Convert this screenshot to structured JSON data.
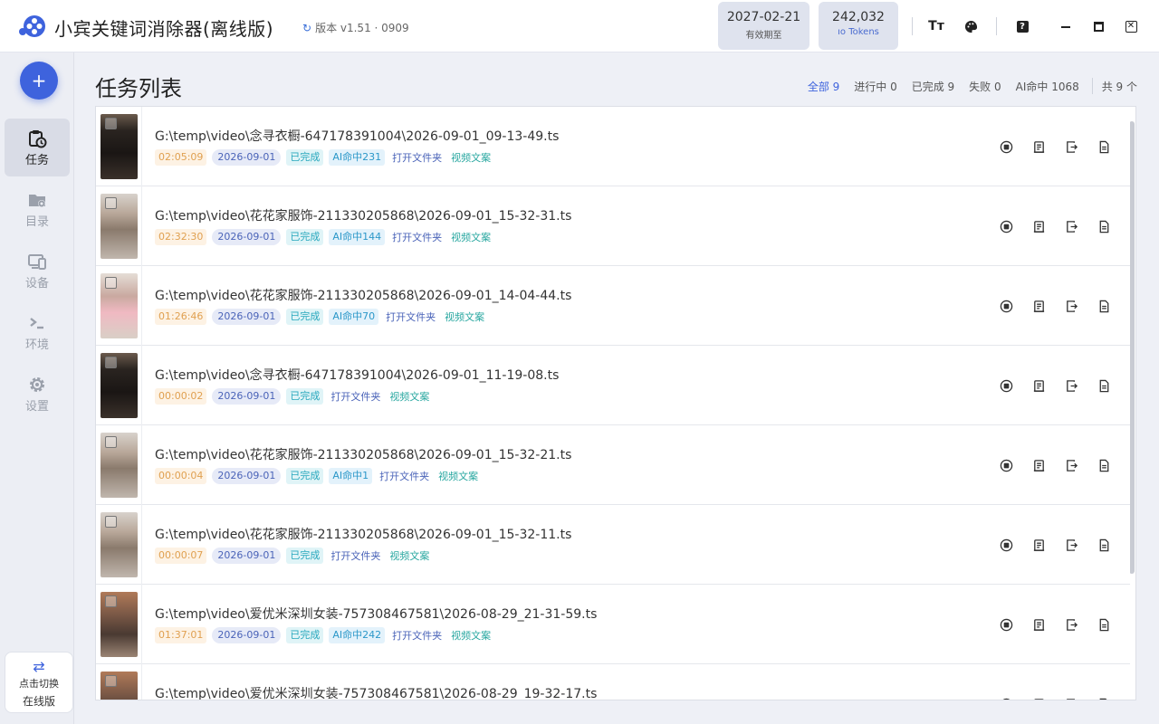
{
  "app": {
    "title": "小宾关键词消除器(离线版)",
    "version": "版本 v1.51 · 0909",
    "expiry_date": "2027-02-21",
    "expiry_label": "有效期至",
    "tokens_value": "242,032",
    "tokens_label": "Tokens"
  },
  "toolbar": {
    "font_btn": "Tт",
    "help_btn": "?"
  },
  "sidebar": {
    "add_label": "+",
    "items": [
      {
        "label": "任务",
        "icon": "task-icon",
        "active": true
      },
      {
        "label": "目录",
        "icon": "folder-gear-icon",
        "active": false
      },
      {
        "label": "设备",
        "icon": "device-icon",
        "active": false
      },
      {
        "label": "环境",
        "icon": "terminal-icon",
        "active": false
      },
      {
        "label": "设置",
        "icon": "gear-icon",
        "active": false
      }
    ],
    "switch": {
      "line1": "点击切换",
      "line2": "在线版"
    }
  },
  "page": {
    "title": "任务列表",
    "filters": {
      "all": "全部 9",
      "running": "进行中 0",
      "done": "已完成 9",
      "failed": "失败 0",
      "ai_hits": "AI命中 1068",
      "total": "共 9 个"
    }
  },
  "colors": {
    "accent": "#3e63dd",
    "duration": "#e0a050",
    "done": "#28a7bd"
  },
  "link_labels": {
    "open_folder": "打开文件夹",
    "video_text": "视频文案"
  },
  "tasks": [
    {
      "path": "G:\\temp\\video\\念寻衣橱-647178391004\\2026-09-01_09-13-49.ts",
      "duration": "02:05:09",
      "date": "2026-09-01",
      "status": "已完成",
      "ai": "AI命中231",
      "thumb": "dark"
    },
    {
      "path": "G:\\temp\\video\\花花家服饰-211330205868\\2026-09-01_15-32-31.ts",
      "duration": "02:32:30",
      "date": "2026-09-01",
      "status": "已完成",
      "ai": "AI命中144",
      "thumb": "light"
    },
    {
      "path": "G:\\temp\\video\\花花家服饰-211330205868\\2026-09-01_14-04-44.ts",
      "duration": "01:26:46",
      "date": "2026-09-01",
      "status": "已完成",
      "ai": "AI命中70",
      "thumb": "pink"
    },
    {
      "path": "G:\\temp\\video\\念寻衣橱-647178391004\\2026-09-01_11-19-08.ts",
      "duration": "00:00:02",
      "date": "2026-09-01",
      "status": "已完成",
      "ai": "",
      "thumb": "dark"
    },
    {
      "path": "G:\\temp\\video\\花花家服饰-211330205868\\2026-09-01_15-32-21.ts",
      "duration": "00:00:04",
      "date": "2026-09-01",
      "status": "已完成",
      "ai": "AI命中1",
      "thumb": "light"
    },
    {
      "path": "G:\\temp\\video\\花花家服饰-211330205868\\2026-09-01_15-32-11.ts",
      "duration": "00:00:07",
      "date": "2026-09-01",
      "status": "已完成",
      "ai": "",
      "thumb": "light"
    },
    {
      "path": "G:\\temp\\video\\爱优米深圳女装-757308467581\\2026-08-29_21-31-59.ts",
      "duration": "01:37:01",
      "date": "2026-09-01",
      "status": "已完成",
      "ai": "AI命中242",
      "thumb": "warm"
    },
    {
      "path": "G:\\temp\\video\\爱优米深圳女装-757308467581\\2026-08-29_19-32-17.ts",
      "duration": "",
      "date": "",
      "status": "",
      "ai": "",
      "thumb": "warm"
    }
  ]
}
